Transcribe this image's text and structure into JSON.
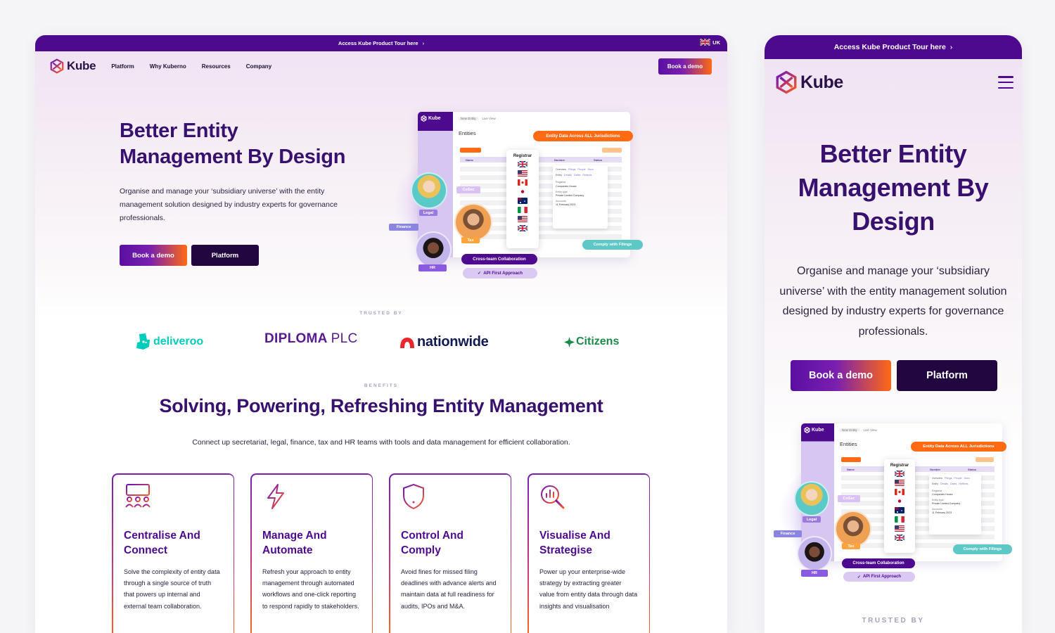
{
  "colors": {
    "brand_purple": "#4e0a8f",
    "heading_purple": "#38106e",
    "accent_orange": "#ff6a13",
    "dark_button": "#22063f",
    "teal": "#5ec8c7"
  },
  "desktop": {
    "topbar": {
      "text": "Access Kube Product Tour here",
      "chevron": "›",
      "lang": "UK"
    },
    "nav": {
      "logo": "Kube",
      "links": [
        "Platform",
        "Why Kuberno",
        "Resources",
        "Company"
      ],
      "cta": "Book a demo"
    },
    "hero": {
      "title_line1": "Better Entity",
      "title_line2": "Management By Design",
      "subtitle": "Organise and manage your ‘subsidiary universe’ with the entity management solution designed by industry experts for governance professionals.",
      "btn_primary": "Book a demo",
      "btn_secondary": "Platform"
    },
    "trusted_label": "TRUSTED BY",
    "logos": {
      "deliveroo": "deliveroo",
      "diploma": "DIPLOMA",
      "diploma_suffix": "PLC",
      "nationwide": "nationwide",
      "citizens": "Citizens"
    },
    "benefits_label": "BENEFITS",
    "benefits_title": "Solving, Powering, Refreshing Entity Management",
    "benefits_sub": "Connect up secretariat, legal, finance, tax and HR teams with tools and data management for efficient collaboration.",
    "cards": [
      {
        "icon": "people-board-icon",
        "title": "Centralise And Connect",
        "text": "Solve the complexity of entity data through a single source of truth that powers up internal and external team collaboration."
      },
      {
        "icon": "lightning-icon",
        "title": "Manage And Automate",
        "text": "Refresh your approach to entity management through automated workflows and one-click reporting to respond rapidly to stakeholders."
      },
      {
        "icon": "shield-alert-icon",
        "title": "Control And Comply",
        "text": "Avoid fines for missed filing deadlines with advance alerts and maintain data at full readiness for audits, IPOs and M&A."
      },
      {
        "icon": "chart-magnifier-icon",
        "title": "Visualise And Strategise",
        "text": "Power up your enterprise-wide strategy by extracting greater value from entity data through data insights and visualisation"
      }
    ]
  },
  "mockup": {
    "app_logo": "Kube",
    "new_entity": "New Entity",
    "live_view": "Live View",
    "entities": "Entities",
    "col_name": "Name",
    "col_number": "Number",
    "col_status": "Status",
    "registrar": "Registrar",
    "badge_data": "Entity Data Across ALL Jurisdictions",
    "badge_collab": "Cross-team Collaboration",
    "badge_api": "API First Approach",
    "badge_filings": "Comply with Filings",
    "labels": {
      "legal": "Legal",
      "finance": "Finance",
      "cosec": "CoSec",
      "tax": "Tax",
      "hr": "HR"
    },
    "detail": {
      "tabs": [
        "Overview",
        "Filings",
        "People",
        "Docs"
      ],
      "subtabs": [
        "Entity",
        "Details",
        "Dates",
        "Reflects"
      ],
      "registrar_label": "Registrar",
      "registrar_value": "Companies House",
      "type_label": "Entity type",
      "type_value": "Private Limited Company",
      "accounts_label": "Accounts",
      "accounts_value": "11 February 2023"
    }
  },
  "mobile": {
    "topbar": {
      "text": "Access Kube Product Tour here",
      "chevron": "›"
    },
    "logo": "Kube",
    "hero": {
      "title": "Better Entity Management By Design",
      "subtitle": "Organise and manage your ‘subsidiary universe’ with the entity management solution designed by industry experts for governance professionals.",
      "btn_primary": "Book a demo",
      "btn_secondary": "Platform"
    },
    "trusted_label": "TRUSTED BY"
  }
}
